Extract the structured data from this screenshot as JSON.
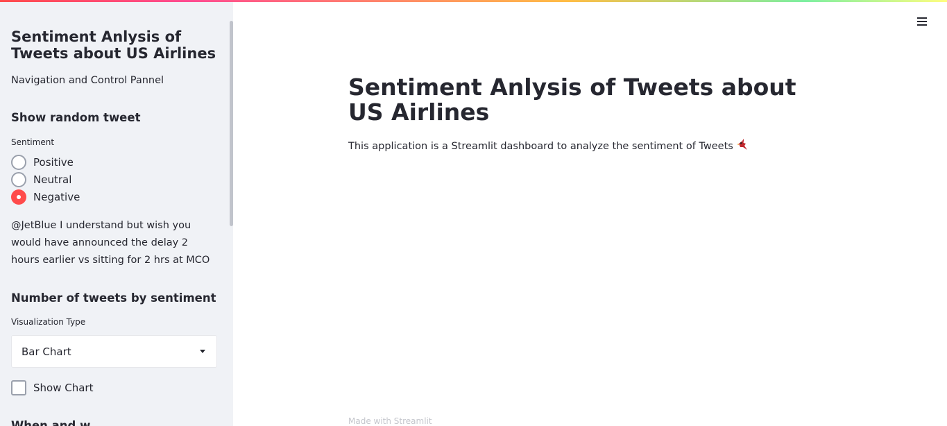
{
  "sidebar": {
    "title": "Sentiment Anlysis of Tweets about US Airlines",
    "subtitle": "Navigation and Control Pannel",
    "random_tweet": {
      "heading": "Show random tweet",
      "label": "Sentiment",
      "options": [
        "Positive",
        "Neutral",
        "Negative"
      ],
      "selected": "Negative",
      "tweet_text": "@JetBlue I understand but wish you would have announced the delay 2 hours earlier vs sitting for 2 hrs at MCO"
    },
    "by_sentiment": {
      "heading": "Number of tweets by sentiment",
      "select_label": "Visualization Type",
      "select_value": "Bar Chart",
      "checkbox_label": "Show Chart"
    },
    "next_heading_partial": "When and w..."
  },
  "main": {
    "title": "Sentiment Anlysis of Tweets about US Airlines",
    "description": "This application is a Streamlit dashboard to analyze the sentiment of Tweets",
    "emoji_icon": "cardinal-bird-icon"
  },
  "footer": {
    "text": "Made with Streamlit"
  },
  "colors": {
    "accent": "#ff4b4b",
    "sidebar_bg": "#f0f2f6",
    "text": "#262730"
  }
}
